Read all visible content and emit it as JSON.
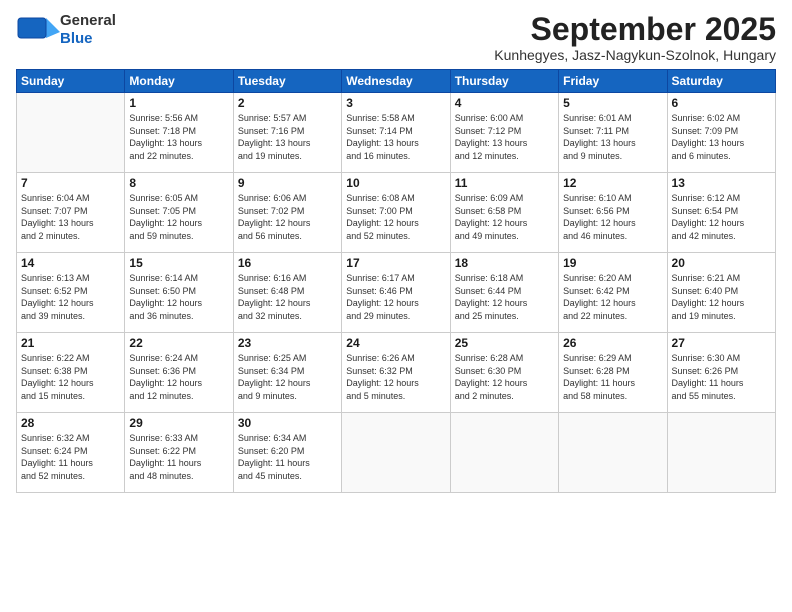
{
  "header": {
    "logo_general": "General",
    "logo_blue": "Blue",
    "month_title": "September 2025",
    "location": "Kunhegyes, Jasz-Nagykun-Szolnok, Hungary"
  },
  "days_of_week": [
    "Sunday",
    "Monday",
    "Tuesday",
    "Wednesday",
    "Thursday",
    "Friday",
    "Saturday"
  ],
  "weeks": [
    [
      {
        "day": "",
        "info": ""
      },
      {
        "day": "1",
        "info": "Sunrise: 5:56 AM\nSunset: 7:18 PM\nDaylight: 13 hours\nand 22 minutes."
      },
      {
        "day": "2",
        "info": "Sunrise: 5:57 AM\nSunset: 7:16 PM\nDaylight: 13 hours\nand 19 minutes."
      },
      {
        "day": "3",
        "info": "Sunrise: 5:58 AM\nSunset: 7:14 PM\nDaylight: 13 hours\nand 16 minutes."
      },
      {
        "day": "4",
        "info": "Sunrise: 6:00 AM\nSunset: 7:12 PM\nDaylight: 13 hours\nand 12 minutes."
      },
      {
        "day": "5",
        "info": "Sunrise: 6:01 AM\nSunset: 7:11 PM\nDaylight: 13 hours\nand 9 minutes."
      },
      {
        "day": "6",
        "info": "Sunrise: 6:02 AM\nSunset: 7:09 PM\nDaylight: 13 hours\nand 6 minutes."
      }
    ],
    [
      {
        "day": "7",
        "info": "Sunrise: 6:04 AM\nSunset: 7:07 PM\nDaylight: 13 hours\nand 2 minutes."
      },
      {
        "day": "8",
        "info": "Sunrise: 6:05 AM\nSunset: 7:05 PM\nDaylight: 12 hours\nand 59 minutes."
      },
      {
        "day": "9",
        "info": "Sunrise: 6:06 AM\nSunset: 7:02 PM\nDaylight: 12 hours\nand 56 minutes."
      },
      {
        "day": "10",
        "info": "Sunrise: 6:08 AM\nSunset: 7:00 PM\nDaylight: 12 hours\nand 52 minutes."
      },
      {
        "day": "11",
        "info": "Sunrise: 6:09 AM\nSunset: 6:58 PM\nDaylight: 12 hours\nand 49 minutes."
      },
      {
        "day": "12",
        "info": "Sunrise: 6:10 AM\nSunset: 6:56 PM\nDaylight: 12 hours\nand 46 minutes."
      },
      {
        "day": "13",
        "info": "Sunrise: 6:12 AM\nSunset: 6:54 PM\nDaylight: 12 hours\nand 42 minutes."
      }
    ],
    [
      {
        "day": "14",
        "info": "Sunrise: 6:13 AM\nSunset: 6:52 PM\nDaylight: 12 hours\nand 39 minutes."
      },
      {
        "day": "15",
        "info": "Sunrise: 6:14 AM\nSunset: 6:50 PM\nDaylight: 12 hours\nand 36 minutes."
      },
      {
        "day": "16",
        "info": "Sunrise: 6:16 AM\nSunset: 6:48 PM\nDaylight: 12 hours\nand 32 minutes."
      },
      {
        "day": "17",
        "info": "Sunrise: 6:17 AM\nSunset: 6:46 PM\nDaylight: 12 hours\nand 29 minutes."
      },
      {
        "day": "18",
        "info": "Sunrise: 6:18 AM\nSunset: 6:44 PM\nDaylight: 12 hours\nand 25 minutes."
      },
      {
        "day": "19",
        "info": "Sunrise: 6:20 AM\nSunset: 6:42 PM\nDaylight: 12 hours\nand 22 minutes."
      },
      {
        "day": "20",
        "info": "Sunrise: 6:21 AM\nSunset: 6:40 PM\nDaylight: 12 hours\nand 19 minutes."
      }
    ],
    [
      {
        "day": "21",
        "info": "Sunrise: 6:22 AM\nSunset: 6:38 PM\nDaylight: 12 hours\nand 15 minutes."
      },
      {
        "day": "22",
        "info": "Sunrise: 6:24 AM\nSunset: 6:36 PM\nDaylight: 12 hours\nand 12 minutes."
      },
      {
        "day": "23",
        "info": "Sunrise: 6:25 AM\nSunset: 6:34 PM\nDaylight: 12 hours\nand 9 minutes."
      },
      {
        "day": "24",
        "info": "Sunrise: 6:26 AM\nSunset: 6:32 PM\nDaylight: 12 hours\nand 5 minutes."
      },
      {
        "day": "25",
        "info": "Sunrise: 6:28 AM\nSunset: 6:30 PM\nDaylight: 12 hours\nand 2 minutes."
      },
      {
        "day": "26",
        "info": "Sunrise: 6:29 AM\nSunset: 6:28 PM\nDaylight: 11 hours\nand 58 minutes."
      },
      {
        "day": "27",
        "info": "Sunrise: 6:30 AM\nSunset: 6:26 PM\nDaylight: 11 hours\nand 55 minutes."
      }
    ],
    [
      {
        "day": "28",
        "info": "Sunrise: 6:32 AM\nSunset: 6:24 PM\nDaylight: 11 hours\nand 52 minutes."
      },
      {
        "day": "29",
        "info": "Sunrise: 6:33 AM\nSunset: 6:22 PM\nDaylight: 11 hours\nand 48 minutes."
      },
      {
        "day": "30",
        "info": "Sunrise: 6:34 AM\nSunset: 6:20 PM\nDaylight: 11 hours\nand 45 minutes."
      },
      {
        "day": "",
        "info": ""
      },
      {
        "day": "",
        "info": ""
      },
      {
        "day": "",
        "info": ""
      },
      {
        "day": "",
        "info": ""
      }
    ]
  ]
}
